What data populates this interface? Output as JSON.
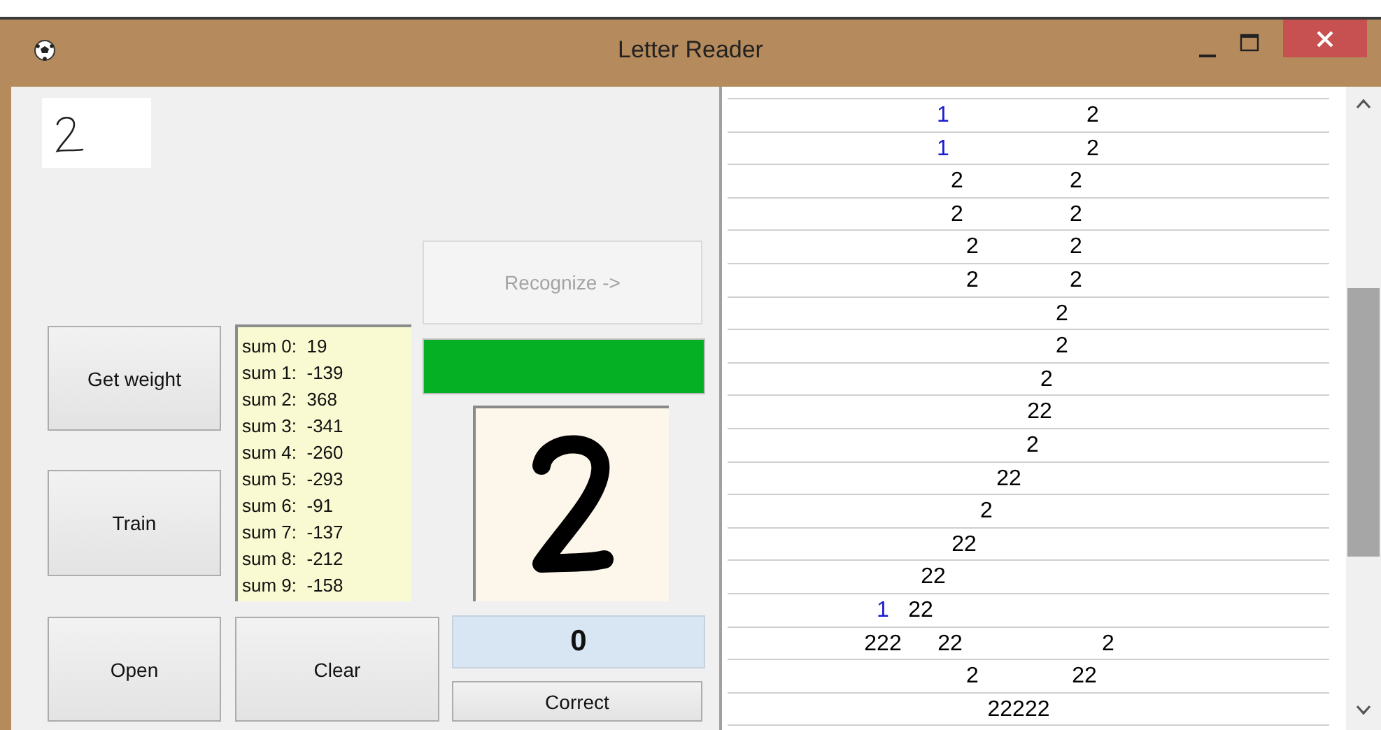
{
  "window": {
    "title": "Letter Reader"
  },
  "recognize": {
    "label": "Recognize ->",
    "disabled": true
  },
  "progress": {
    "level": 1
  },
  "buttons": {
    "get_weight": "Get weight",
    "train": "Train",
    "open": "Open",
    "clear": "Clear",
    "correct": "Correct"
  },
  "sums": [
    "sum 0:  19",
    "sum 1:  -139",
    "sum 2:  368",
    "sum 3:  -341",
    "sum 4:  -260",
    "sum 5:  -293",
    "sum 6:  -91",
    "sum 7:  -137",
    "sum 8:  -212",
    "sum 9:  -158"
  ],
  "result_count": "0",
  "output_rows": [
    {
      "tokens": [
        {
          "text": "1",
          "color": "#1c1cd0"
        },
        {
          "text": "2",
          "color": "#000000"
        }
      ]
    },
    {
      "tokens": [
        {
          "text": "1",
          "color": "#1c1cd0"
        },
        {
          "text": "2",
          "color": "#000000"
        }
      ]
    },
    {
      "tokens": [
        {
          "text": "2",
          "color": "#000000"
        },
        {
          "text": "2",
          "color": "#000000"
        }
      ]
    },
    {
      "tokens": [
        {
          "text": "2",
          "color": "#000000"
        },
        {
          "text": "2",
          "color": "#000000"
        }
      ]
    },
    {
      "tokens": [
        {
          "text": "2",
          "color": "#000000"
        },
        {
          "text": "2",
          "color": "#000000"
        }
      ]
    },
    {
      "tokens": [
        {
          "text": "2",
          "color": "#000000"
        },
        {
          "text": "2",
          "color": "#000000"
        }
      ]
    },
    {
      "tokens": [
        {
          "text": "2",
          "color": "#000000"
        }
      ]
    },
    {
      "tokens": [
        {
          "text": "2",
          "color": "#000000"
        }
      ]
    },
    {
      "tokens": [
        {
          "text": "2",
          "color": "#000000"
        }
      ]
    },
    {
      "tokens": [
        {
          "text": "22",
          "color": "#000000"
        }
      ]
    },
    {
      "tokens": [
        {
          "text": "2",
          "color": "#000000"
        }
      ]
    },
    {
      "tokens": [
        {
          "text": "22",
          "color": "#000000"
        }
      ]
    },
    {
      "tokens": [
        {
          "text": "2",
          "color": "#000000"
        }
      ]
    },
    {
      "tokens": [
        {
          "text": "22",
          "color": "#000000"
        }
      ]
    },
    {
      "tokens": [
        {
          "text": "22",
          "color": "#000000"
        }
      ]
    },
    {
      "tokens": [
        {
          "text": "1",
          "color": "#1c1cd0"
        },
        {
          "text": "22",
          "color": "#000000"
        }
      ]
    },
    {
      "tokens": [
        {
          "text": "222",
          "color": "#000000"
        },
        {
          "text": "22",
          "color": "#000000"
        },
        {
          "text": "2",
          "color": "#000000"
        }
      ]
    },
    {
      "tokens": [
        {
          "text": "2",
          "color": "#000000"
        },
        {
          "text": "22",
          "color": "#000000"
        }
      ]
    },
    {
      "tokens": [
        {
          "text": "22222",
          "color": "#000000"
        }
      ]
    }
  ]
}
